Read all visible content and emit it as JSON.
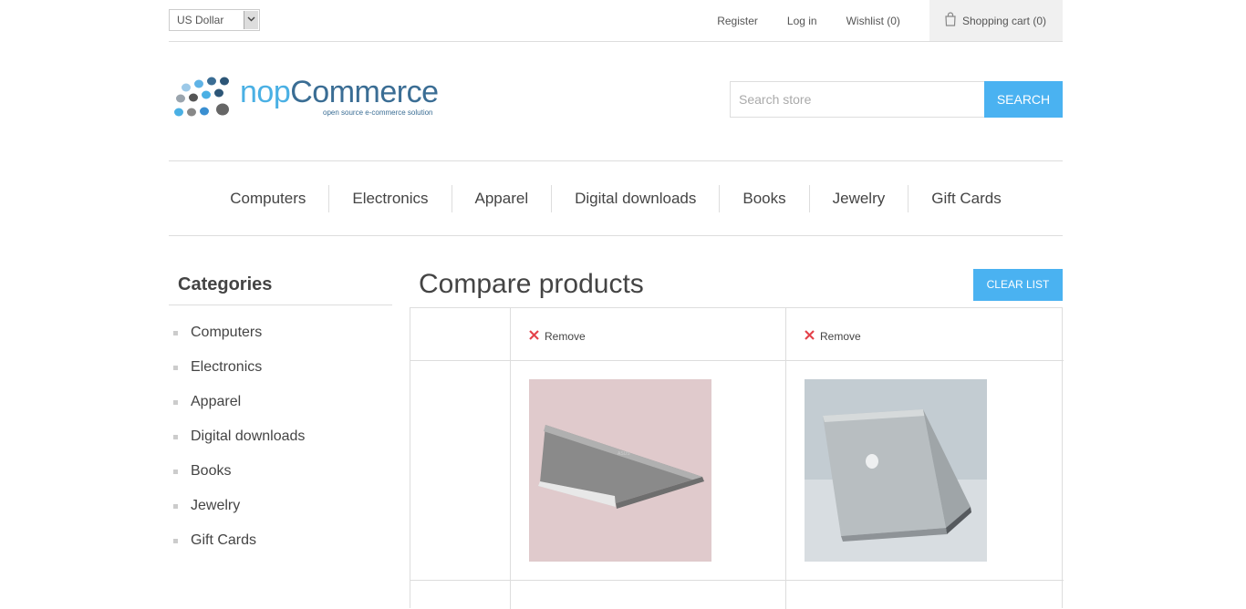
{
  "header": {
    "currency": "US Dollar",
    "links": {
      "register": "Register",
      "login": "Log in",
      "wishlist": "Wishlist (0)",
      "cart": "Shopping cart (0)"
    }
  },
  "logo": {
    "word_prefix": "nop",
    "word_suffix": "Commerce",
    "tagline": "open source e-commerce solution"
  },
  "search": {
    "placeholder": "Search store",
    "button": "SEARCH"
  },
  "menu": [
    "Computers",
    "Electronics",
    "Apparel",
    "Digital downloads",
    "Books",
    "Jewelry",
    "Gift Cards"
  ],
  "sidebar": {
    "title": "Categories",
    "items": [
      "Computers",
      "Electronics",
      "Apparel",
      "Digital downloads",
      "Books",
      "Jewelry",
      "Gift Cards"
    ]
  },
  "main": {
    "title": "Compare products",
    "clear_button": "CLEAR LIST",
    "products": [
      {
        "remove_label": "Remove"
      },
      {
        "remove_label": "Remove"
      }
    ]
  },
  "colors": {
    "accent": "#4ab2f1",
    "remove_x": "#e4434b"
  }
}
